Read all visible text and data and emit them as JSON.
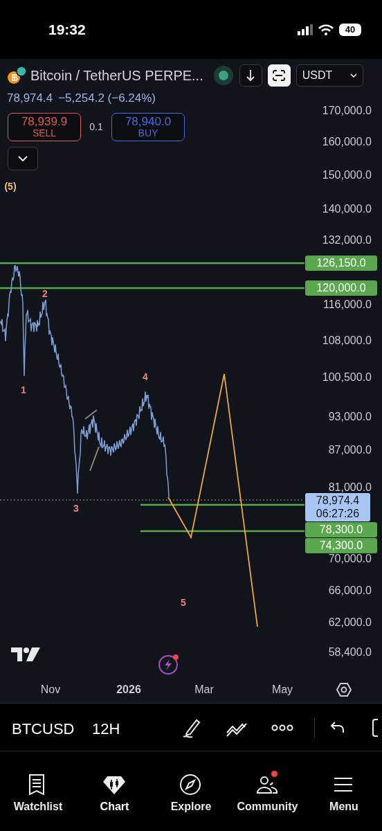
{
  "status_bar": {
    "time": "19:32",
    "battery": "40"
  },
  "header": {
    "title": "Bitcoin / TetherUS PERPE...",
    "currency": "USDT",
    "price": "78,974.4",
    "change": "−5,254.2 (−6.24%)"
  },
  "trade": {
    "sell": {
      "price": "78,939.9",
      "label": "SELL"
    },
    "spread": "0.1",
    "buy": {
      "price": "78,940.0",
      "label": "BUY"
    }
  },
  "chart": {
    "wave_labels": [
      {
        "text": "(5)",
        "kind": "major"
      },
      {
        "text": "1",
        "kind": "minor"
      },
      {
        "text": "2",
        "kind": "minor"
      },
      {
        "text": "3",
        "kind": "minor"
      },
      {
        "text": "4",
        "kind": "minor"
      },
      {
        "text": "5",
        "kind": "minor"
      }
    ],
    "y_axis": [
      "170,000.0",
      "160,000.0",
      "150,000.0",
      "140,000.0",
      "132,000.0",
      "116,000.0",
      "108,000.0",
      "100,500.0",
      "93,000.0",
      "87,000.0",
      "81,000.0",
      "70,000.0",
      "66,000.0",
      "62,000.0",
      "58,400.0"
    ],
    "level_lines": [
      {
        "price": "126,150.0"
      },
      {
        "price": "120,000.0"
      },
      {
        "price": "78,300.0"
      },
      {
        "price": "74,300.0"
      }
    ],
    "last_price": {
      "price": "78,974.4",
      "countdown": "06:27:26"
    },
    "x_axis": [
      {
        "text": "Nov",
        "bold": false
      },
      {
        "text": "2026",
        "bold": true
      },
      {
        "text": "Mar",
        "bold": false
      },
      {
        "text": "May",
        "bold": false
      }
    ]
  },
  "toolbar": {
    "symbol": "BTCUSD",
    "interval": "12H"
  },
  "tabs": [
    {
      "label": "Watchlist",
      "selected": false,
      "badge": false
    },
    {
      "label": "Chart",
      "selected": true,
      "badge": false
    },
    {
      "label": "Explore",
      "selected": false,
      "badge": false
    },
    {
      "label": "Community",
      "selected": false,
      "badge": true
    },
    {
      "label": "Menu",
      "selected": false,
      "badge": false
    }
  ]
}
